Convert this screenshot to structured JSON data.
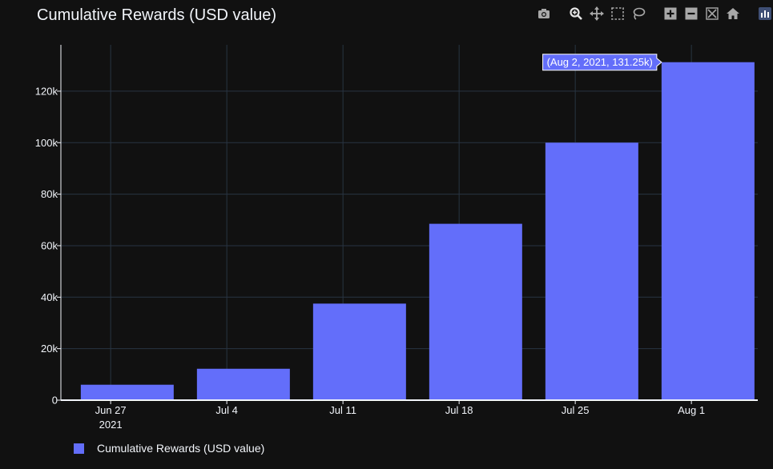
{
  "toolbar": {
    "icons": [
      "camera-icon",
      "zoom-icon",
      "pan-icon",
      "box-select-icon",
      "lasso-icon",
      "zoom-in-icon",
      "zoom-out-icon",
      "autoscale-icon",
      "reset-axes-icon",
      "plotly-logo-icon"
    ],
    "icon_color": "#a8a8a8"
  },
  "chart_data": {
    "type": "bar",
    "title": "Cumulative Rewards (USD value)",
    "xlabel": "",
    "ylabel": "",
    "categories": [
      "2021-06-28",
      "2021-07-05",
      "2021-07-12",
      "2021-07-19",
      "2021-07-26",
      "2021-08-02"
    ],
    "series": [
      {
        "name": "Cumulative Rewards (USD value)",
        "values": [
          6000,
          12200,
          37500,
          68500,
          100000,
          131250
        ],
        "color": "#636efa"
      }
    ],
    "x_ticks": [
      {
        "date": "2021-06-27",
        "label": "Jun 27",
        "sublabel": "2021"
      },
      {
        "date": "2021-07-04",
        "label": "Jul 4"
      },
      {
        "date": "2021-07-11",
        "label": "Jul 11"
      },
      {
        "date": "2021-07-18",
        "label": "Jul 18"
      },
      {
        "date": "2021-07-25",
        "label": "Jul 25"
      },
      {
        "date": "2021-08-01",
        "label": "Aug 1"
      }
    ],
    "y_ticks": [
      {
        "value": 0,
        "label": "0"
      },
      {
        "value": 20000,
        "label": "20k"
      },
      {
        "value": 40000,
        "label": "40k"
      },
      {
        "value": 60000,
        "label": "60k"
      },
      {
        "value": 80000,
        "label": "80k"
      },
      {
        "value": 100000,
        "label": "100k"
      },
      {
        "value": 120000,
        "label": "120k"
      }
    ],
    "xlim": [
      "2021-06-24",
      "2021-08-05"
    ],
    "ylim": [
      0,
      138000
    ],
    "grid": true,
    "legend": "bottom-left",
    "hover_label": {
      "text": "(Aug 2, 2021, 131.25k)",
      "series_index": 0,
      "point_index": 5
    },
    "background": "#111111",
    "grid_color": "#283442",
    "bar_color": "#636efa"
  }
}
